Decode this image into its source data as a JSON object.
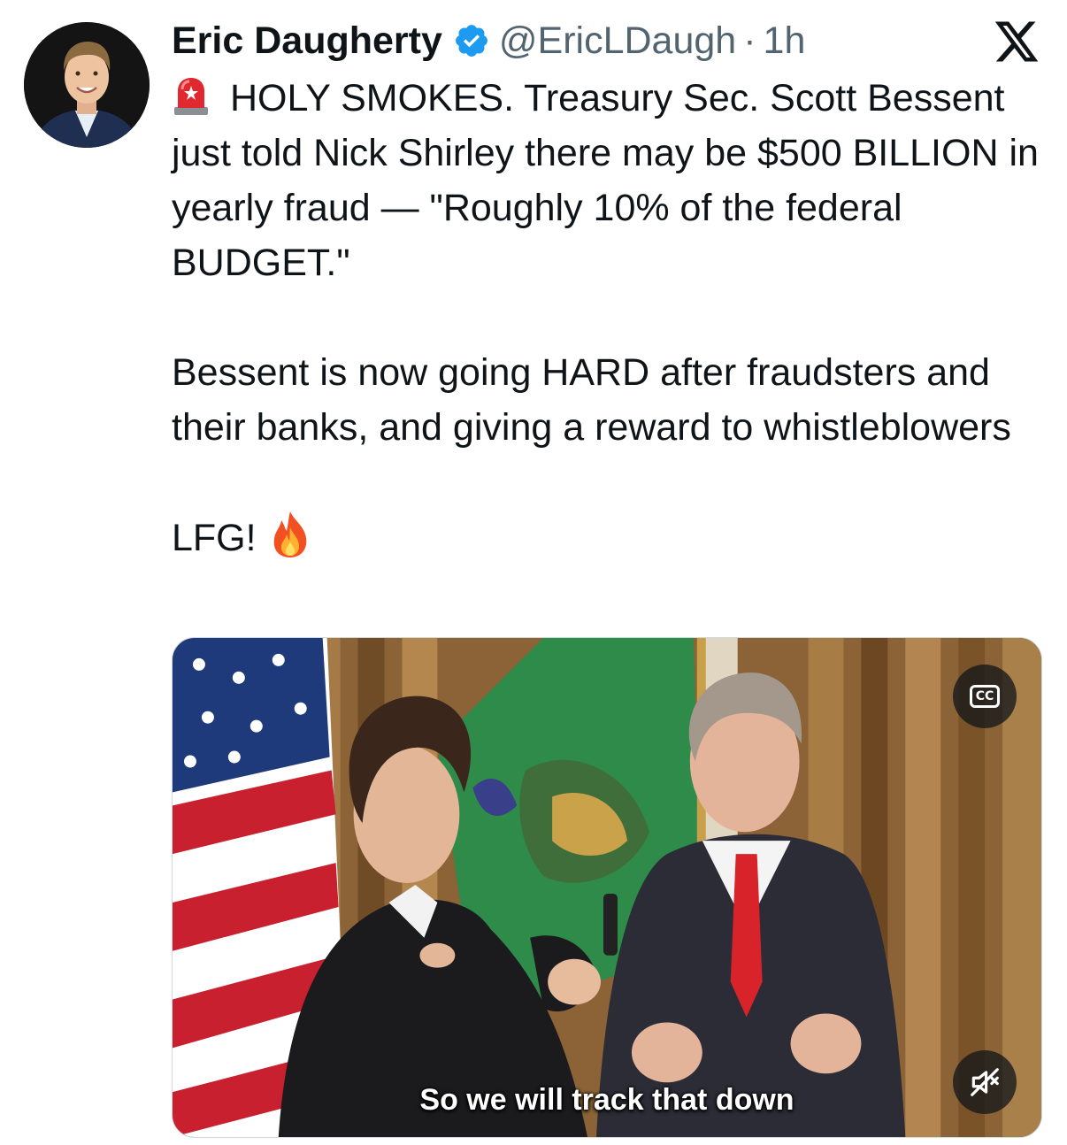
{
  "author": {
    "display_name": "Eric Daugherty",
    "handle": "@EricLDaugh",
    "separator": "·",
    "time": "1h",
    "verified": true
  },
  "icons": {
    "verified": "verified-badge-icon",
    "platform": "x-logo-icon",
    "siren": "police-siren-emoji",
    "fire": "fire-emoji",
    "captions": "closed-captions-icon",
    "mute": "speaker-muted-icon"
  },
  "post": {
    "paragraph1": "HOLY SMOKES. Treasury Sec. Scott Bessent just told Nick Shirley there may be $500 BILLION in yearly fraud — \"Roughly 10% of the federal BUDGET.\"",
    "paragraph2": "Bessent is now going HARD after fraudsters and their banks, and giving a reward to whistleblowers",
    "paragraph3": "LFG!"
  },
  "media": {
    "type": "video",
    "caption": "So we will track that down",
    "cc_label": "CC"
  },
  "colors": {
    "verified_blue": "#1d9bf0",
    "secondary_text": "#536471",
    "primary_text": "#0f1419"
  }
}
